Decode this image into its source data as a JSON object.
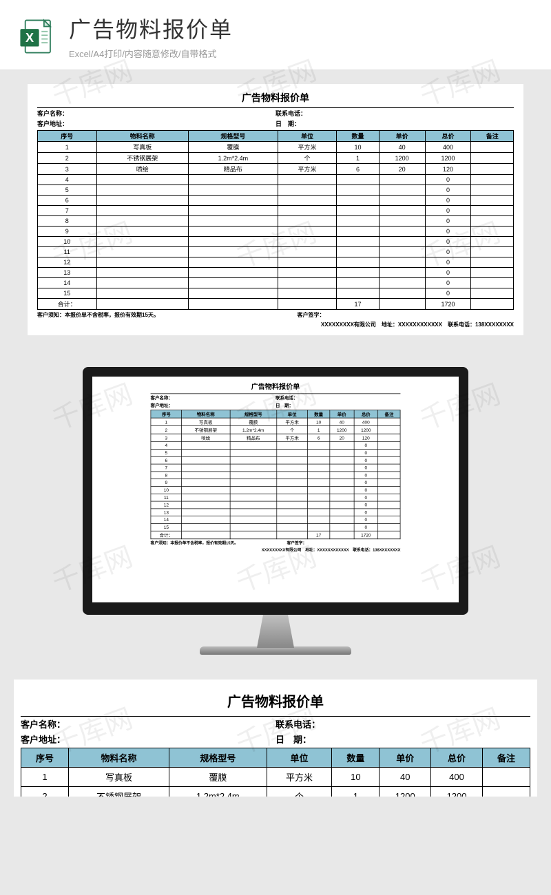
{
  "header": {
    "title": "广告物料报价单",
    "subtitle": "Excel/A4打印/内容随意修改/自带格式"
  },
  "sheet": {
    "title": "广告物料报价单",
    "info": {
      "customer_name_label": "客户名称：",
      "phone_label": "联系电话：",
      "address_label": "客户地址：",
      "date_label": "日　期："
    },
    "columns": [
      "序号",
      "物料名称",
      "规格型号",
      "单位",
      "数量",
      "单价",
      "总价",
      "备注"
    ],
    "rows": [
      {
        "no": "1",
        "name": "写真板",
        "spec": "覆膜",
        "unit": "平方米",
        "qty": "10",
        "price": "40",
        "total": "400",
        "remark": ""
      },
      {
        "no": "2",
        "name": "不锈钢展架",
        "spec": "1.2m*2.4m",
        "unit": "个",
        "qty": "1",
        "price": "1200",
        "total": "1200",
        "remark": ""
      },
      {
        "no": "3",
        "name": "喷绘",
        "spec": "精品布",
        "unit": "平方米",
        "qty": "6",
        "price": "20",
        "total": "120",
        "remark": ""
      },
      {
        "no": "4",
        "name": "",
        "spec": "",
        "unit": "",
        "qty": "",
        "price": "",
        "total": "0",
        "remark": ""
      },
      {
        "no": "5",
        "name": "",
        "spec": "",
        "unit": "",
        "qty": "",
        "price": "",
        "total": "0",
        "remark": ""
      },
      {
        "no": "6",
        "name": "",
        "spec": "",
        "unit": "",
        "qty": "",
        "price": "",
        "total": "0",
        "remark": ""
      },
      {
        "no": "7",
        "name": "",
        "spec": "",
        "unit": "",
        "qty": "",
        "price": "",
        "total": "0",
        "remark": ""
      },
      {
        "no": "8",
        "name": "",
        "spec": "",
        "unit": "",
        "qty": "",
        "price": "",
        "total": "0",
        "remark": ""
      },
      {
        "no": "9",
        "name": "",
        "spec": "",
        "unit": "",
        "qty": "",
        "price": "",
        "total": "0",
        "remark": ""
      },
      {
        "no": "10",
        "name": "",
        "spec": "",
        "unit": "",
        "qty": "",
        "price": "",
        "total": "0",
        "remark": ""
      },
      {
        "no": "11",
        "name": "",
        "spec": "",
        "unit": "",
        "qty": "",
        "price": "",
        "total": "0",
        "remark": ""
      },
      {
        "no": "12",
        "name": "",
        "spec": "",
        "unit": "",
        "qty": "",
        "price": "",
        "total": "0",
        "remark": ""
      },
      {
        "no": "13",
        "name": "",
        "spec": "",
        "unit": "",
        "qty": "",
        "price": "",
        "total": "0",
        "remark": ""
      },
      {
        "no": "14",
        "name": "",
        "spec": "",
        "unit": "",
        "qty": "",
        "price": "",
        "total": "0",
        "remark": ""
      },
      {
        "no": "15",
        "name": "",
        "spec": "",
        "unit": "",
        "qty": "",
        "price": "",
        "total": "0",
        "remark": ""
      }
    ],
    "sum": {
      "label": "合计：",
      "qty": "17",
      "total": "1720"
    },
    "note": "客户须知：本报价单不含税率，报价有效期15天。",
    "sign": "客户签字：",
    "company": "XXXXXXXXX有限公司　地址：XXXXXXXXXXXX　联系电话：138XXXXXXXX"
  },
  "watermark": "千库网"
}
